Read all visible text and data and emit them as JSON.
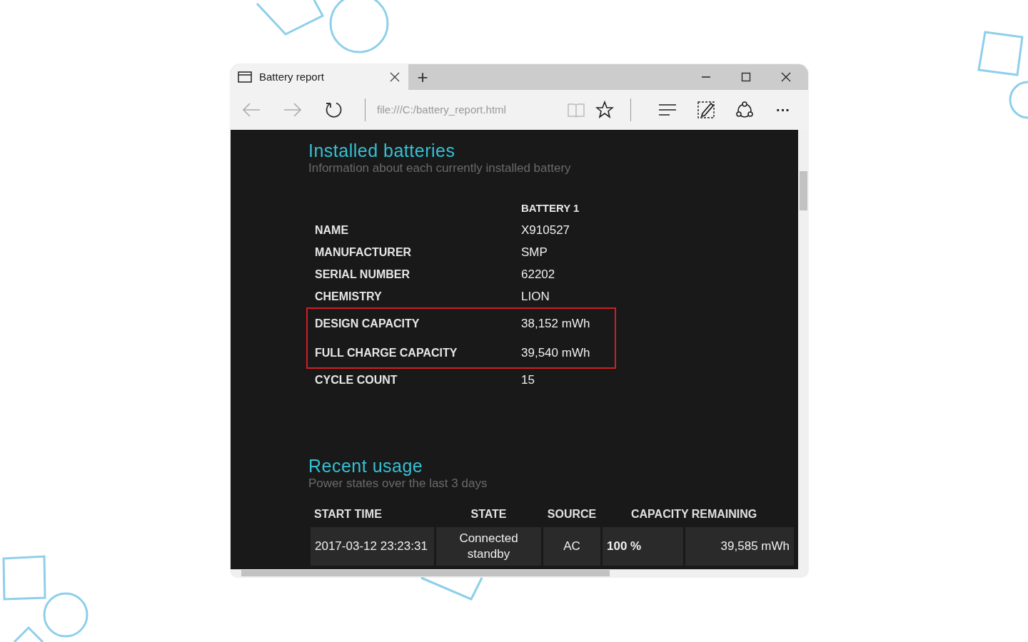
{
  "browser": {
    "tab": {
      "title": "Battery report",
      "selected": true
    },
    "new_tab": "+",
    "address": "file:///C:/battery_report.html",
    "more": "···"
  },
  "installed_batteries": {
    "title": "Installed batteries",
    "subtitle": "Information about each currently installed battery",
    "column_header": "BATTERY 1",
    "rows": [
      {
        "label": "NAME",
        "value": "X910527",
        "highlighted": false
      },
      {
        "label": "MANUFACTURER",
        "value": "SMP",
        "highlighted": false
      },
      {
        "label": "SERIAL NUMBER",
        "value": "62202",
        "highlighted": false
      },
      {
        "label": "CHEMISTRY",
        "value": "LION",
        "highlighted": false
      },
      {
        "label": "DESIGN CAPACITY",
        "value": "38,152 mWh",
        "highlighted": true
      },
      {
        "label": "FULL CHARGE CAPACITY",
        "value": "39,540 mWh",
        "highlighted": true
      },
      {
        "label": "CYCLE COUNT",
        "value": "15",
        "highlighted": false
      }
    ]
  },
  "recent_usage": {
    "title": "Recent usage",
    "subtitle": "Power states over the last 3 days",
    "columns": [
      "START TIME",
      "STATE",
      "SOURCE",
      "CAPACITY REMAINING"
    ],
    "rows": [
      {
        "start_time": "2017-03-12 23:23:31",
        "state": "Connected standby",
        "source": "AC",
        "percent": "100 %",
        "energy": "39,585 mWh"
      }
    ]
  }
}
